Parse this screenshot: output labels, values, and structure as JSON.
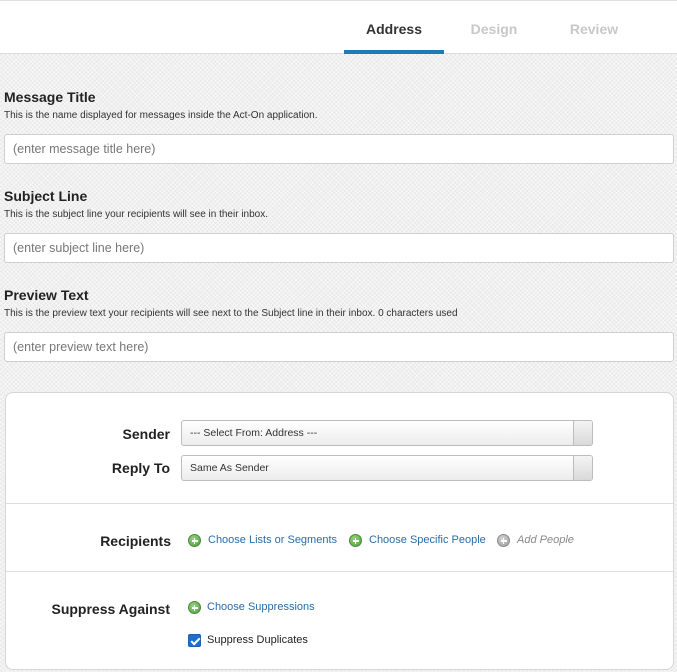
{
  "tabs": [
    {
      "label": "Address",
      "active": true
    },
    {
      "label": "Design",
      "active": false
    },
    {
      "label": "Review",
      "active": false
    }
  ],
  "accent_color": "#1f7ab8",
  "message_title": {
    "label": "Message Title",
    "help": "This is the name displayed for messages inside the Act-On application.",
    "placeholder": "(enter message title here)"
  },
  "subject_line": {
    "label": "Subject Line",
    "help": "This is the subject line your recipients will see in their inbox.",
    "placeholder": "(enter subject line here)"
  },
  "preview_text": {
    "label": "Preview Text",
    "help": "This is the preview text your recipients will see next to the Subject line in their inbox. 0 characters used",
    "placeholder": "(enter preview text here)"
  },
  "sender": {
    "label": "Sender",
    "selected": "--- Select From: Address ---"
  },
  "reply_to": {
    "label": "Reply To",
    "selected": "Same As Sender"
  },
  "recipients": {
    "label": "Recipients",
    "choose_lists": "Choose Lists or Segments",
    "choose_people": "Choose Specific People",
    "add_people": "Add People"
  },
  "suppress": {
    "label": "Suppress Against",
    "choose_suppressions": "Choose Suppressions",
    "duplicates_label": "Suppress Duplicates",
    "duplicates_checked": true
  }
}
